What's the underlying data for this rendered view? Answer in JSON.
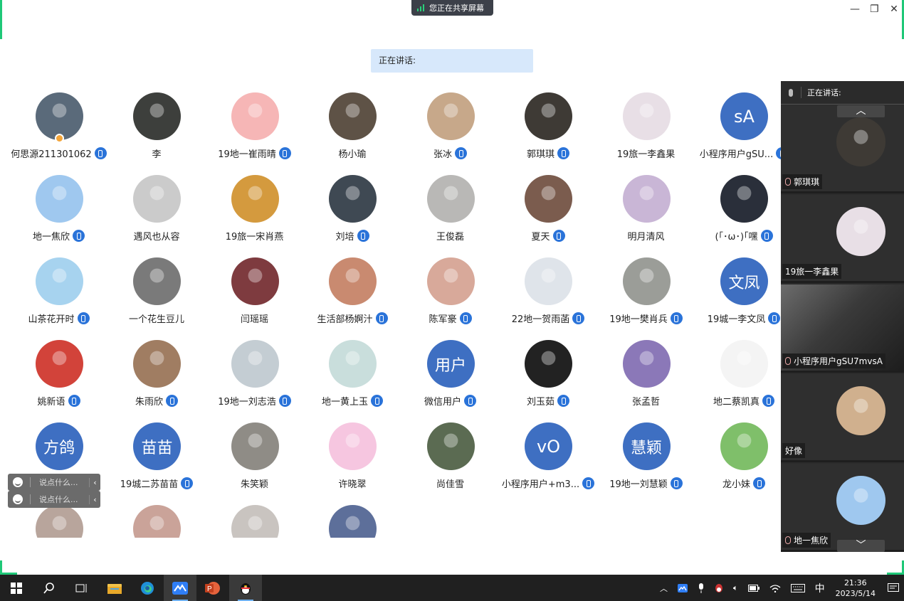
{
  "share_banner": {
    "text": "您正在共享屏幕"
  },
  "speaking_bar": {
    "label": "正在讲话:"
  },
  "participants": [
    {
      "name": "何思源211301062",
      "mic": true,
      "avatar": "photo",
      "color": "#5a6a7a",
      "host": true
    },
    {
      "name": "李",
      "mic": false,
      "avatar": "photo",
      "color": "#3d3f3c"
    },
    {
      "name": "19地一崔雨晴",
      "mic": true,
      "avatar": "photo",
      "color": "#f6b6b6"
    },
    {
      "name": "杨小瑜",
      "mic": false,
      "avatar": "photo",
      "color": "#5e5246"
    },
    {
      "name": "张冰",
      "mic": true,
      "avatar": "photo",
      "color": "#c7a88a"
    },
    {
      "name": "郭琪琪",
      "mic": true,
      "avatar": "photo",
      "color": "#3e3a35"
    },
    {
      "name": "19旅一李鑫果",
      "mic": false,
      "avatar": "photo",
      "color": "#e8dfe6"
    },
    {
      "name": "小程序用户gSU...",
      "mic": true,
      "avatar": "text",
      "initials": "sA"
    },
    {
      "name": "地一焦欣",
      "mic": true,
      "avatar": "photo",
      "color": "#9fc8ef"
    },
    {
      "name": "遇风也从容",
      "mic": false,
      "avatar": "photo",
      "color": "#cbcbcb"
    },
    {
      "name": "19旅一宋肖燕",
      "mic": false,
      "avatar": "photo",
      "color": "#d49a3e"
    },
    {
      "name": "刘培",
      "mic": true,
      "avatar": "photo",
      "color": "#3f4953"
    },
    {
      "name": "王俊磊",
      "mic": false,
      "avatar": "photo",
      "color": "#b9b8b6"
    },
    {
      "name": "夏天",
      "mic": true,
      "avatar": "photo",
      "color": "#7b5c4e"
    },
    {
      "name": "明月清风",
      "mic": false,
      "avatar": "photo",
      "color": "#c9b6d6"
    },
    {
      "name": "(｢･ω･)｢嘿",
      "mic": true,
      "avatar": "photo",
      "color": "#2a2f3a"
    },
    {
      "name": "山茶花开时",
      "mic": true,
      "avatar": "photo",
      "color": "#a7d3ef"
    },
    {
      "name": "一个花生豆儿",
      "mic": false,
      "avatar": "photo",
      "color": "#7a7a7a"
    },
    {
      "name": "闫瑶瑶",
      "mic": false,
      "avatar": "photo",
      "color": "#7e3b3f"
    },
    {
      "name": "生活部杨婀汁",
      "mic": true,
      "avatar": "photo",
      "color": "#c98a70"
    },
    {
      "name": "陈军豪",
      "mic": true,
      "avatar": "photo",
      "color": "#d8a99a"
    },
    {
      "name": "22地一贺雨菡",
      "mic": true,
      "avatar": "photo",
      "color": "#dfe4ea"
    },
    {
      "name": "19地一樊肖兵",
      "mic": true,
      "avatar": "photo",
      "color": "#9b9d98"
    },
    {
      "name": "19城一李文凤",
      "mic": true,
      "avatar": "text",
      "initials": "文凤"
    },
    {
      "name": "姚新语",
      "mic": true,
      "avatar": "photo",
      "color": "#d2433a"
    },
    {
      "name": "朱雨欣",
      "mic": true,
      "avatar": "photo",
      "color": "#a07d62"
    },
    {
      "name": "19地一刘志浩",
      "mic": true,
      "avatar": "photo",
      "color": "#c4cdd3"
    },
    {
      "name": "地一黄上玉",
      "mic": true,
      "avatar": "photo",
      "color": "#c9dedc"
    },
    {
      "name": "微信用户",
      "mic": true,
      "avatar": "text",
      "initials": "用户"
    },
    {
      "name": "刘玉茹",
      "mic": true,
      "avatar": "photo",
      "color": "#222222"
    },
    {
      "name": "张孟哲",
      "mic": false,
      "avatar": "photo",
      "color": "#8b78b8"
    },
    {
      "name": "地二蔡凯真",
      "mic": true,
      "avatar": "photo",
      "color": "#f4f4f4"
    },
    {
      "name": "方鸽",
      "mic": true,
      "avatar": "text",
      "initials": "方鸽"
    },
    {
      "name": "19城二苏苗苗",
      "mic": true,
      "avatar": "text",
      "initials": "苗苗"
    },
    {
      "name": "朱笑颖",
      "mic": false,
      "avatar": "photo",
      "color": "#8f8c86"
    },
    {
      "name": "许晓翠",
      "mic": false,
      "avatar": "photo",
      "color": "#f6c6e0"
    },
    {
      "name": "尚佳雪",
      "mic": false,
      "avatar": "photo",
      "color": "#5b6b52"
    },
    {
      "name": "小程序用户+m3...",
      "mic": true,
      "avatar": "text",
      "initials": "vO"
    },
    {
      "name": "19地一刘慧颖",
      "mic": true,
      "avatar": "text",
      "initials": "慧颖"
    },
    {
      "name": "龙小妹",
      "mic": true,
      "avatar": "photo",
      "color": "#7fbf6a"
    },
    {
      "name": "",
      "mic": false,
      "avatar": "photo",
      "color": "#b8a59c"
    },
    {
      "name": "",
      "mic": false,
      "avatar": "photo",
      "color": "#caa399"
    },
    {
      "name": "",
      "mic": false,
      "avatar": "photo",
      "color": "#c9c4c0"
    },
    {
      "name": "",
      "mic": false,
      "avatar": "photo",
      "color": "#5d6f9a"
    }
  ],
  "chat_inputs": [
    {
      "placeholder": "说点什么..."
    },
    {
      "placeholder": "说点什么..."
    }
  ],
  "side_panel": {
    "header": "正在讲话:",
    "cards": [
      {
        "name": "郭琪琪",
        "mic": true,
        "color": "#3e3a35"
      },
      {
        "name": "19旅一李鑫果",
        "mic": false,
        "color": "#e8dfe6"
      },
      {
        "name": "小程序用户gSU7mvsA",
        "mic": true,
        "color": "#4a4a4a",
        "video": true
      },
      {
        "name": "好像",
        "mic": false,
        "color": "#d0b08e"
      },
      {
        "name": "地一焦欣",
        "mic": true,
        "color": "#9fc8ef"
      }
    ]
  },
  "taskbar": {
    "ime": "中",
    "time": "21:36",
    "date": "2023/5/14"
  },
  "colors": {
    "accent": "#2a73d9",
    "share_green": "#1fc878",
    "avatar_text_bg": "#3e6fc2"
  }
}
